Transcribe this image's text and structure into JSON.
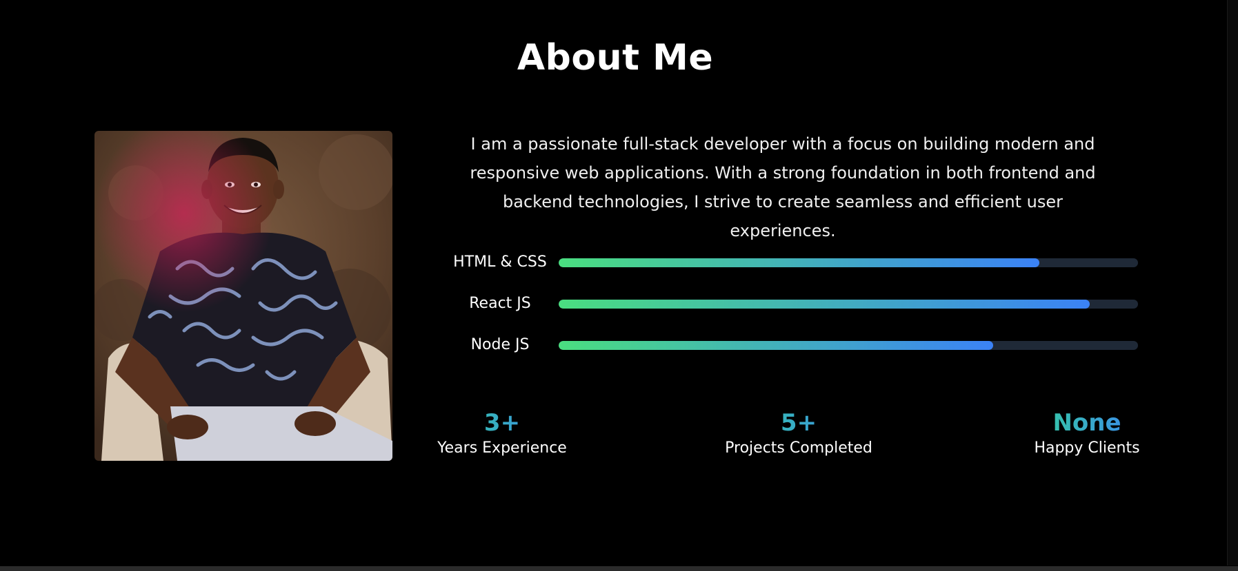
{
  "section": {
    "title": "About Me"
  },
  "about": {
    "bio": "I am a passionate full-stack developer with a focus on building modern and responsive web applications. With a strong foundation in both frontend and backend technologies, I strive to create seamless and efficient user experiences.",
    "photo_icon": "portrait-photo"
  },
  "skills": [
    {
      "label": "HTML & CSS",
      "level": 0.83
    },
    {
      "label": "React JS",
      "level": 0.917
    },
    {
      "label": "Node JS",
      "level": 0.75
    }
  ],
  "stats": [
    {
      "value": "3+",
      "label": "Years Experience"
    },
    {
      "value": "5+",
      "label": "Projects Completed"
    },
    {
      "value": "None",
      "label": "Happy Clients"
    }
  ],
  "colors": {
    "background": "#000000",
    "accent_start": "#4ade80",
    "accent_end": "#3b82f6",
    "track": "#1f2937"
  }
}
